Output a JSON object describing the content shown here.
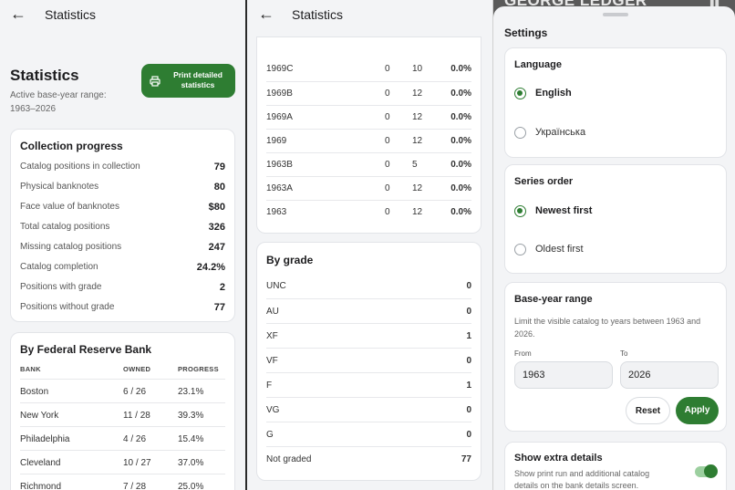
{
  "screen1": {
    "topbar_title": "Statistics",
    "page_title": "Statistics",
    "range_label": "Active base-year range:",
    "range_value": "1963–2026",
    "print_button": "Print detailed statistics",
    "collection": {
      "title": "Collection progress",
      "rows": [
        {
          "label": "Catalog positions in collection",
          "value": "79"
        },
        {
          "label": "Physical banknotes",
          "value": "80"
        },
        {
          "label": "Face value of banknotes",
          "value": "$80"
        },
        {
          "label": "Total catalog positions",
          "value": "326"
        },
        {
          "label": "Missing catalog positions",
          "value": "247"
        },
        {
          "label": "Catalog completion",
          "value": "24.2%"
        },
        {
          "label": "Positions with grade",
          "value": "2"
        },
        {
          "label": "Positions without grade",
          "value": "77"
        }
      ]
    },
    "frb": {
      "title": "By Federal Reserve Bank",
      "headers": [
        "BANK",
        "OWNED",
        "PROGRESS"
      ],
      "rows": [
        {
          "bank": "Boston",
          "owned": "6 / 26",
          "progress": "23.1%"
        },
        {
          "bank": "New York",
          "owned": "11 / 28",
          "progress": "39.3%"
        },
        {
          "bank": "Philadelphia",
          "owned": "4 / 26",
          "progress": "15.4%"
        },
        {
          "bank": "Cleveland",
          "owned": "10 / 27",
          "progress": "37.0%"
        },
        {
          "bank": "Richmond",
          "owned": "7 / 28",
          "progress": "25.0%"
        }
      ]
    }
  },
  "screen2": {
    "topbar_title": "Statistics",
    "series_rows": [
      {
        "series": "1969C",
        "a": "0",
        "b": "10",
        "pct": "0.0%"
      },
      {
        "series": "1969B",
        "a": "0",
        "b": "12",
        "pct": "0.0%"
      },
      {
        "series": "1969A",
        "a": "0",
        "b": "12",
        "pct": "0.0%"
      },
      {
        "series": "1969",
        "a": "0",
        "b": "12",
        "pct": "0.0%"
      },
      {
        "series": "1963B",
        "a": "0",
        "b": "5",
        "pct": "0.0%"
      },
      {
        "series": "1963A",
        "a": "0",
        "b": "12",
        "pct": "0.0%"
      },
      {
        "series": "1963",
        "a": "0",
        "b": "12",
        "pct": "0.0%"
      }
    ],
    "grade": {
      "title": "By grade",
      "rows": [
        {
          "grade": "UNC",
          "count": "0"
        },
        {
          "grade": "AU",
          "count": "0"
        },
        {
          "grade": "XF",
          "count": "1"
        },
        {
          "grade": "VF",
          "count": "0"
        },
        {
          "grade": "F",
          "count": "1"
        },
        {
          "grade": "VG",
          "count": "0"
        },
        {
          "grade": "G",
          "count": "0"
        },
        {
          "grade": "Not graded",
          "count": "77"
        }
      ]
    }
  },
  "screen3": {
    "backdrop_title": "GEORGE LEDGER",
    "sheet_title": "Settings",
    "language": {
      "title": "Language",
      "options": [
        "English",
        "Українська"
      ],
      "selected": "English"
    },
    "series_order": {
      "title": "Series order",
      "options": [
        "Newest first",
        "Oldest first"
      ],
      "selected": "Newest first"
    },
    "base_year": {
      "title": "Base-year range",
      "description": "Limit the visible catalog to years between 1963 and 2026.",
      "from_label": "From",
      "to_label": "To",
      "from_value": "1963",
      "to_value": "2026",
      "reset_label": "Reset",
      "apply_label": "Apply"
    },
    "extra": {
      "title": "Show extra details",
      "description": "Show print run and additional catalog details on the bank details screen.",
      "enabled": true
    }
  },
  "colors": {
    "accent": "#2e7d32",
    "background": "#f3f4f6",
    "card": "#ffffff"
  }
}
